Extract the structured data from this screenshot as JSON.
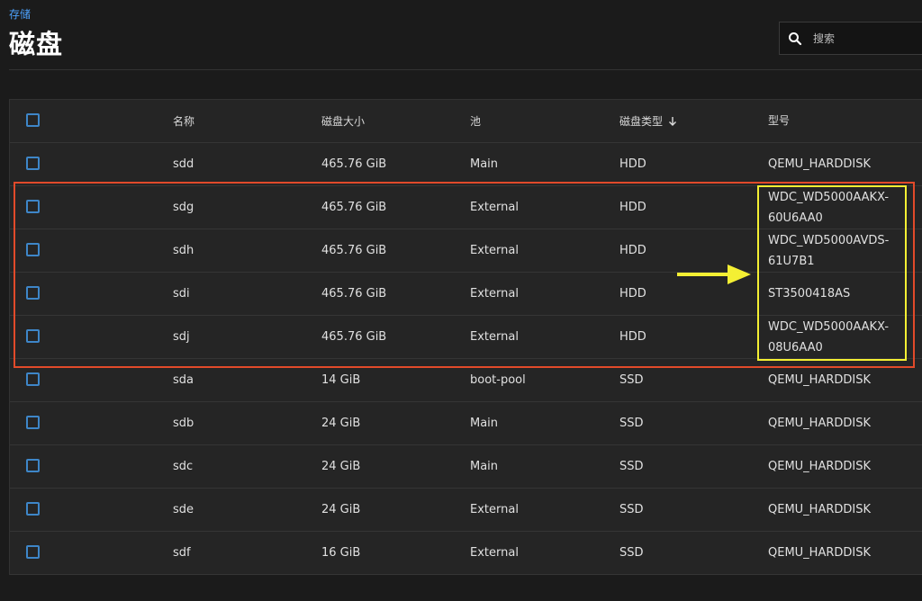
{
  "breadcrumb": "存储",
  "page_title": "磁盘",
  "search": {
    "placeholder": "搜索"
  },
  "table": {
    "columns": {
      "name": "名称",
      "size": "磁盘大小",
      "pool": "池",
      "type": "磁盘类型",
      "model": "型号"
    },
    "rows": [
      {
        "name": "sdd",
        "size": "465.76 GiB",
        "pool": "Main",
        "type": "HDD",
        "model": "QEMU_HARDDISK"
      },
      {
        "name": "sdg",
        "size": "465.76 GiB",
        "pool": "External",
        "type": "HDD",
        "model": "WDC_WD5000AAKX-\n60U6AA0"
      },
      {
        "name": "sdh",
        "size": "465.76 GiB",
        "pool": "External",
        "type": "HDD",
        "model": "WDC_WD5000AVDS-\n61U7B1"
      },
      {
        "name": "sdi",
        "size": "465.76 GiB",
        "pool": "External",
        "type": "HDD",
        "model": "ST3500418AS"
      },
      {
        "name": "sdj",
        "size": "465.76 GiB",
        "pool": "External",
        "type": "HDD",
        "model": "WDC_WD5000AAKX-\n08U6AA0"
      },
      {
        "name": "sda",
        "size": "14 GiB",
        "pool": "boot-pool",
        "type": "SSD",
        "model": "QEMU_HARDDISK"
      },
      {
        "name": "sdb",
        "size": "24 GiB",
        "pool": "Main",
        "type": "SSD",
        "model": "QEMU_HARDDISK"
      },
      {
        "name": "sdc",
        "size": "24 GiB",
        "pool": "Main",
        "type": "SSD",
        "model": "QEMU_HARDDISK"
      },
      {
        "name": "sde",
        "size": "24 GiB",
        "pool": "External",
        "type": "SSD",
        "model": "QEMU_HARDDISK"
      },
      {
        "name": "sdf",
        "size": "16 GiB",
        "pool": "External",
        "type": "SSD",
        "model": "QEMU_HARDDISK"
      }
    ]
  },
  "icons": {
    "search": "search-icon",
    "sort": "arrow-down-icon",
    "annotation": "arrow-right-icon"
  },
  "colors": {
    "accent": "#4da3ff",
    "checkbox": "#3e86c8",
    "highlight_red": "#e14a2a",
    "highlight_yellow": "#f4ef33"
  }
}
